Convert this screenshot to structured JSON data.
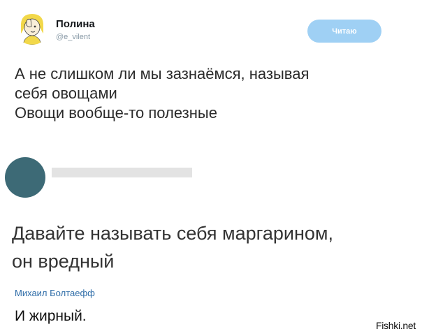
{
  "tweet": {
    "author_name": "Полина",
    "author_handle": "@e_vilent",
    "follow_label": "Читаю",
    "lines": [
      "А не слишком ли мы зазнаёмся, называя",
      "себя овощами",
      "Овощи вообще-то полезные"
    ]
  },
  "reply": {
    "lines": [
      "Давайте называть себя маргарином,",
      "он вредный"
    ]
  },
  "comment": {
    "author": "Михаил Болтаефф",
    "text": "И жирный."
  },
  "watermark": "Fishki.net",
  "colors": {
    "follow_button_bg": "#9fd0f4",
    "reply_avatar": "#3d6a76",
    "comment_author": "#2f6da8",
    "handle_gray": "#8899a6"
  }
}
